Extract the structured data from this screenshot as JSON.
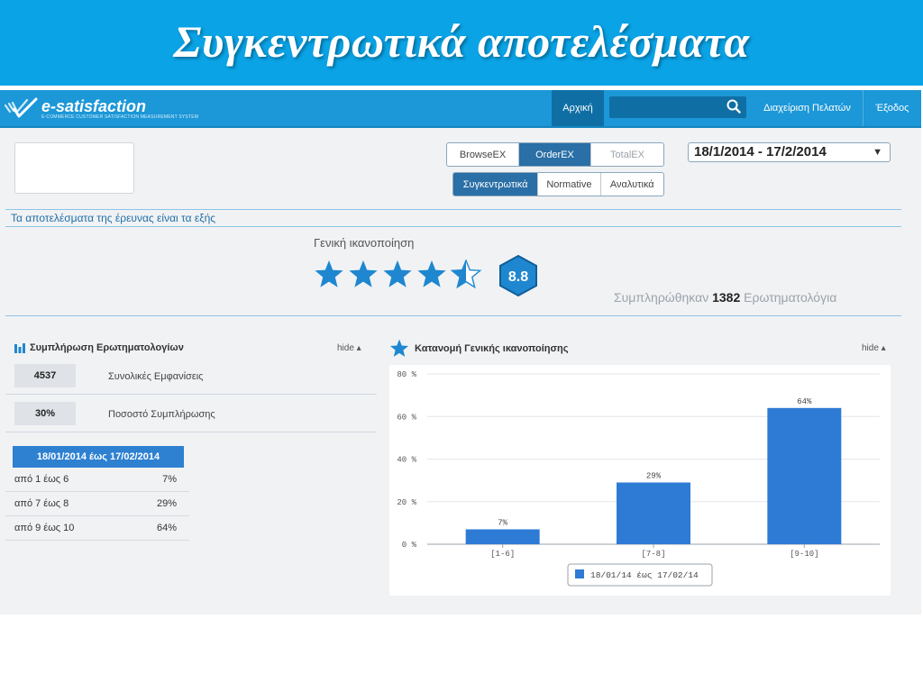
{
  "slide_title": "Συγκεντρωτικά αποτελέσματα",
  "brand": {
    "name": "e-satisfaction",
    "tagline": "E-COMMERCE CUSTOMER SATISFACTION MEASUREMENT SYSTEM",
    "color": "#1c97d7"
  },
  "nav": {
    "home": "Αρχική",
    "search_icon": "search-icon",
    "clients": "Διαχείριση Πελατών",
    "exit": "Έξοδος"
  },
  "filters": {
    "surveys": [
      "BrowseEX",
      "OrderEX",
      "TotalEX"
    ],
    "active_survey": "OrderEX",
    "views": [
      "Συγκεντρωτικά",
      "Normative",
      "Αναλυτικά"
    ],
    "active_view": "Συγκεντρωτικά",
    "date_range": "18/1/2014 - 17/2/2014"
  },
  "results_heading": "Τα αποτελέσματα της έρευνας είναι τα εξής",
  "overall": {
    "label": "Γενική ικανοποίηση",
    "stars": 4.5,
    "score": "8.8",
    "completed_prefix": "Συμπληρώθηκαν",
    "completed_count": "1382",
    "completed_suffix": "Ερωτηματολόγια"
  },
  "left_panel": {
    "title": "Συμπλήρωση Ερωτηματολογίων",
    "hide": "hide",
    "stats": [
      {
        "value": "4537",
        "label": "Συνολικές Εμφανίσεις"
      },
      {
        "value": "30%",
        "label": "Ποσοστό Συμπλήρωσης"
      }
    ],
    "table_header": "18/01/2014 έως 17/02/2014",
    "rows": [
      {
        "range": "από 1 έως 6",
        "pct": "7%"
      },
      {
        "range": "από 7 έως 8",
        "pct": "29%"
      },
      {
        "range": "από 9 έως 10",
        "pct": "64%"
      }
    ]
  },
  "right_panel": {
    "title": "Κατανομή Γενικής ικανοποίησης",
    "hide": "hide"
  },
  "chart_data": {
    "type": "bar",
    "categories": [
      "[1-6]",
      "[7-8]",
      "[9-10]"
    ],
    "series": [
      {
        "name": "18/01/14 έως 17/02/14",
        "values": [
          7,
          29,
          64
        ]
      }
    ],
    "data_labels": [
      "7%",
      "29%",
      "64%"
    ],
    "y_ticks": [
      "0 %",
      "20 %",
      "40 %",
      "60 %",
      "80 %"
    ],
    "ylim": [
      0,
      80
    ],
    "grid": true,
    "legend": "bottom",
    "bar_color": "#2e7bd6"
  }
}
